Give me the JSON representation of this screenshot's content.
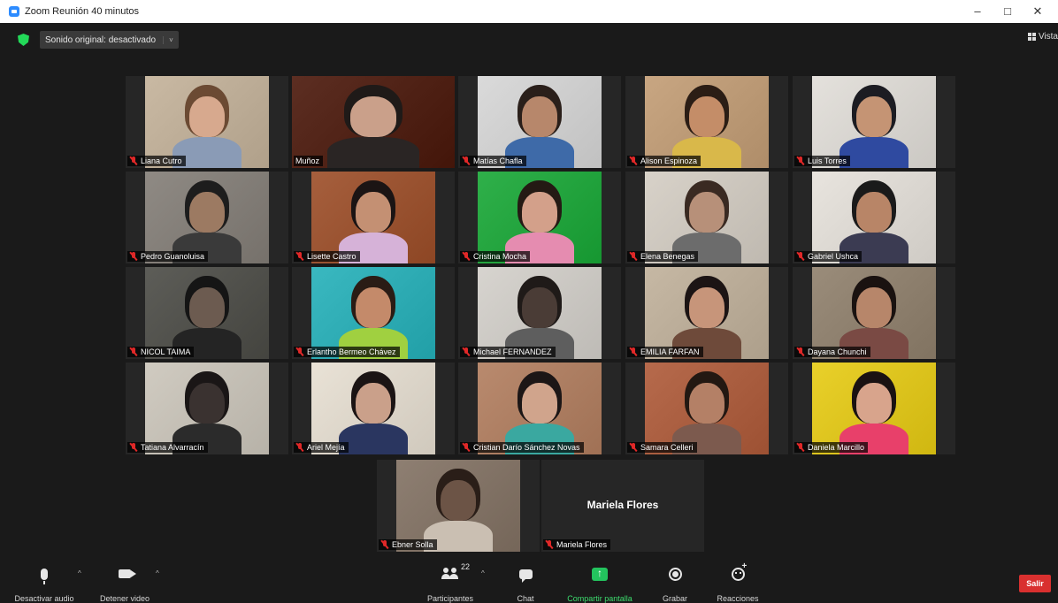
{
  "window": {
    "title": "Zoom Reunión 40 minutos",
    "controls": [
      "–",
      "□",
      "✕"
    ]
  },
  "topbar": {
    "audio_label": "Sonido original: desactivado",
    "audio_caret": "˅",
    "view_label": "Vista"
  },
  "participants": [
    {
      "name": "Liana Cutro",
      "muted": true,
      "colors": {
        "bg": "#c9b9a3",
        "face": "#d7a98e",
        "hair": "#6b4a33",
        "body": "#8a9bb6"
      }
    },
    {
      "name": "Muñoz",
      "muted": false,
      "active": true,
      "colors": {
        "bg": "#5c2e22",
        "face": "#caa08a",
        "hair": "#1f1a18",
        "body": "#2a2524"
      }
    },
    {
      "name": "Matías Chafla",
      "muted": true,
      "colors": {
        "bg": "#dadada",
        "face": "#b7876b",
        "hair": "#2a1f1a",
        "body": "#3e6aa8"
      }
    },
    {
      "name": "Alison Espinoza",
      "muted": true,
      "colors": {
        "bg": "#c8a682",
        "face": "#c48d68",
        "hair": "#2b1d15",
        "body": "#d9b84a"
      }
    },
    {
      "name": "Luis Torres",
      "muted": true,
      "colors": {
        "bg": "#e4e1dc",
        "face": "#c59474",
        "hair": "#1c1c22",
        "body": "#2f4aa0"
      }
    },
    {
      "name": "Pedro Guanoluisa",
      "muted": true,
      "colors": {
        "bg": "#8f8a84",
        "face": "#9c7a62",
        "hair": "#1d1d1d",
        "body": "#3a3a3a"
      }
    },
    {
      "name": "Lisette Castro",
      "muted": true,
      "colors": {
        "bg": "#a65f3d",
        "face": "#c49073",
        "hair": "#1b1414",
        "body": "#d6b2d8"
      }
    },
    {
      "name": "Cristina Mocha",
      "muted": true,
      "colors": {
        "bg": "#2fb04a",
        "face": "#d3a08a",
        "hair": "#241a14",
        "body": "#e58cb0"
      }
    },
    {
      "name": "Elena Benegas",
      "muted": true,
      "colors": {
        "bg": "#d8d2c9",
        "face": "#b79079",
        "hair": "#3a2a22",
        "body": "#6c6c6c"
      }
    },
    {
      "name": "Gabriel Ushca",
      "muted": true,
      "colors": {
        "bg": "#e8e4de",
        "face": "#b88567",
        "hair": "#1a1a1a",
        "body": "#3b3b52"
      }
    },
    {
      "name": "NICOL TAIMA",
      "muted": true,
      "colors": {
        "bg": "#5d5d58",
        "face": "#6c5b50",
        "hair": "#151515",
        "body": "#242424"
      }
    },
    {
      "name": "Erlantho Bermeo Chávez",
      "muted": true,
      "colors": {
        "bg": "#3ab8c0",
        "face": "#c48a6a",
        "hair": "#2a1c15",
        "body": "#a0d040"
      }
    },
    {
      "name": "Michael FERNANDEZ",
      "muted": true,
      "colors": {
        "bg": "#d7d4cf",
        "face": "#4a3c36",
        "hair": "#1f1a18",
        "body": "#5e5e5e"
      }
    },
    {
      "name": "EMILIA FARFAN",
      "muted": true,
      "colors": {
        "bg": "#c6b8a4",
        "face": "#c7957a",
        "hair": "#1c1414",
        "body": "#6e4a3a"
      }
    },
    {
      "name": "Dayana Chunchi",
      "muted": true,
      "colors": {
        "bg": "#9a8c7a",
        "face": "#b7866a",
        "hair": "#1a1210",
        "body": "#7a4a44"
      }
    },
    {
      "name": "Tatiana Alvarracín",
      "muted": true,
      "colors": {
        "bg": "#d0cbc1",
        "face": "#3a3230",
        "hair": "#1a1616",
        "body": "#2b2b2b"
      }
    },
    {
      "name": "Ariel Mejía",
      "muted": true,
      "colors": {
        "bg": "#e9e2d6",
        "face": "#caa08a",
        "hair": "#1b1414",
        "body": "#2a3660"
      }
    },
    {
      "name": "Cristian Darío Sánchez Novas",
      "muted": true,
      "colors": {
        "bg": "#b98a6e",
        "face": "#d0a48c",
        "hair": "#1c1616",
        "body": "#3aa8a0"
      }
    },
    {
      "name": "Samara Celleri",
      "muted": true,
      "colors": {
        "bg": "#b66a4c",
        "face": "#b48066",
        "hair": "#231812",
        "body": "#7c5a4e"
      }
    },
    {
      "name": "Daniela Marcillo",
      "muted": true,
      "colors": {
        "bg": "#e9d02a",
        "face": "#d8a48c",
        "hair": "#1a1212",
        "body": "#e8406a"
      }
    },
    {
      "name": "Ebner Solla",
      "muted": true,
      "colors": {
        "bg": "#8e7f72",
        "face": "#6c5446",
        "hair": "#2a1e18",
        "body": "#cabfb2"
      }
    },
    {
      "name": "Mariela Flores",
      "muted": true,
      "no_video": true,
      "display_name": "Mariela Flores"
    }
  ],
  "toolbar": {
    "mute_label": "Desactivar audio",
    "video_label": "Detener video",
    "participants_label": "Participantes",
    "participants_count": "22",
    "chat_label": "Chat",
    "share_label": "Compartir pantalla",
    "record_label": "Grabar",
    "reactions_label": "Reacciones",
    "leave_label": "Salir",
    "caret": "^"
  },
  "colors": {
    "share_green": "#23c45e",
    "leave_red": "#d9302f",
    "active_speaker": "#c9e06a",
    "muted_red": "#e02828"
  }
}
